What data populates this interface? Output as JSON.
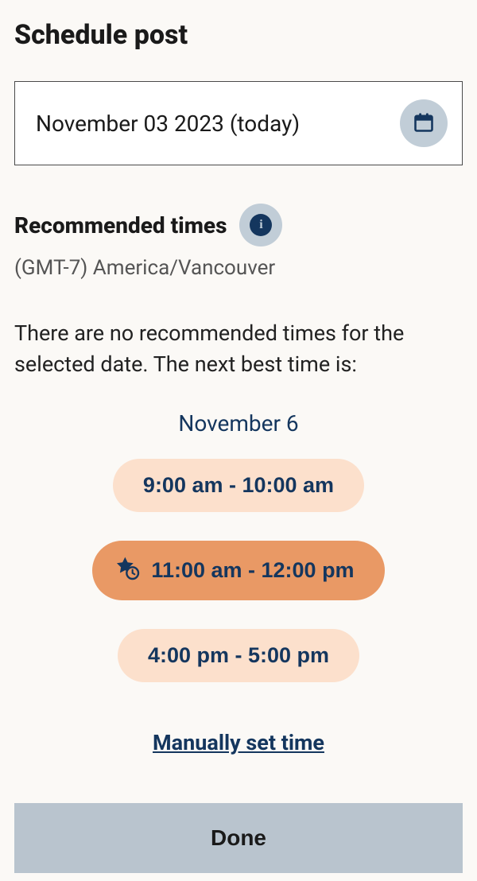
{
  "title": "Schedule post",
  "date_picker": {
    "value": "November 03 2023 (today)"
  },
  "recommended": {
    "heading": "Recommended times",
    "timezone": "(GMT-7) America/Vancouver",
    "no_times_message": "There are no recommended times for the selected date. The next best time is:",
    "alt_date": "November 6",
    "slots": [
      {
        "label": "9:00 am - 10:00 am",
        "selected": false
      },
      {
        "label": "11:00 am - 12:00 pm",
        "selected": true
      },
      {
        "label": "4:00 pm - 5:00 pm",
        "selected": false
      }
    ]
  },
  "manual_link": "Manually set time",
  "done_label": "Done"
}
